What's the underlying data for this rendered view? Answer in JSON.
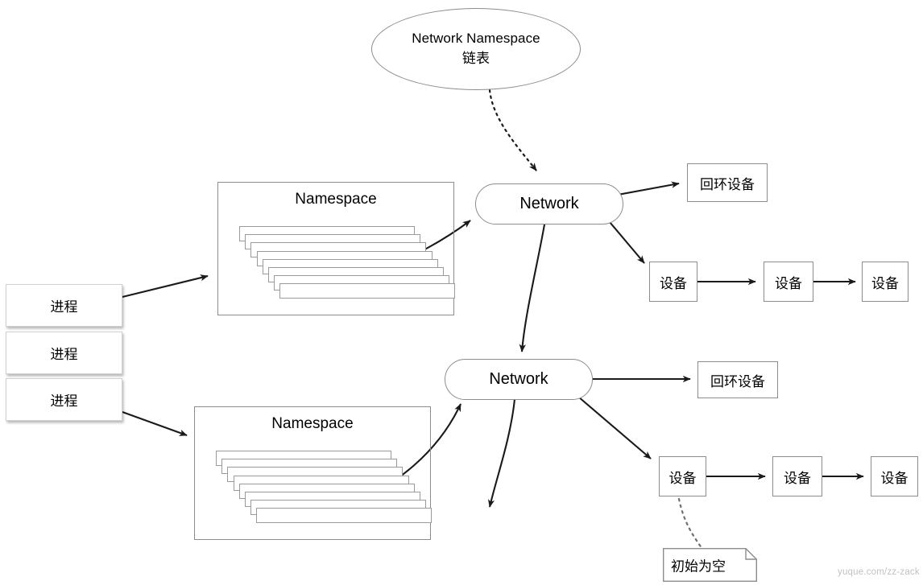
{
  "diagram": {
    "title_node": {
      "line1": "Network Namespace",
      "line2": "链表"
    },
    "networks": [
      {
        "label": "Network"
      },
      {
        "label": "Network"
      }
    ],
    "namespaces": [
      {
        "label": "Namespace",
        "card_count": 8
      },
      {
        "label": "Namespace",
        "card_count": 8
      }
    ],
    "processes": [
      {
        "label": "进程"
      },
      {
        "label": "进程"
      },
      {
        "label": "进程"
      }
    ],
    "loopback_devices": [
      {
        "label": "回环设备"
      },
      {
        "label": "回环设备"
      }
    ],
    "device_chain_top": [
      {
        "label": "设备"
      },
      {
        "label": "设备"
      },
      {
        "label": "设备"
      }
    ],
    "device_chain_bottom": [
      {
        "label": "设备"
      },
      {
        "label": "设备"
      },
      {
        "label": "设备"
      }
    ],
    "note": {
      "label": "初始为空"
    },
    "watermark": "yuque.com/zz-zack"
  },
  "colors": {
    "stroke_gray": "#8c8c8c",
    "stroke_black": "#1a1a1a",
    "card_border": "#9a9a9a",
    "watermark": "#c2c2c2",
    "background": "#ffffff"
  }
}
